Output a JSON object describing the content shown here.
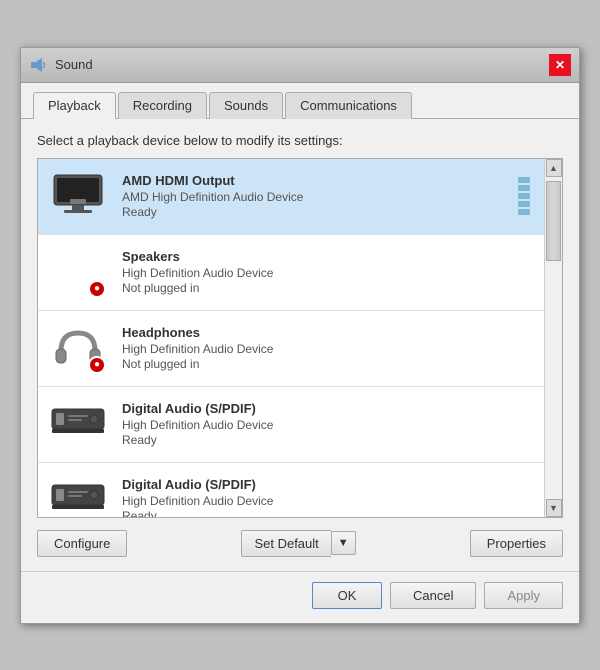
{
  "window": {
    "title": "Sound",
    "icon": "🔊"
  },
  "tabs": [
    {
      "label": "Playback",
      "active": true
    },
    {
      "label": "Recording",
      "active": false
    },
    {
      "label": "Sounds",
      "active": false
    },
    {
      "label": "Communications",
      "active": false
    }
  ],
  "description": "Select a playback device below to modify its settings:",
  "devices": [
    {
      "name": "AMD HDMI Output",
      "driver": "AMD High Definition Audio Device",
      "status": "Ready",
      "selected": true,
      "icon_type": "hdmi",
      "not_plugged": false
    },
    {
      "name": "Speakers",
      "driver": "High Definition Audio Device",
      "status": "Not plugged in",
      "selected": false,
      "icon_type": "speaker",
      "not_plugged": true
    },
    {
      "name": "Headphones",
      "driver": "High Definition Audio Device",
      "status": "Not plugged in",
      "selected": false,
      "icon_type": "headphones",
      "not_plugged": true
    },
    {
      "name": "Digital Audio (S/PDIF)",
      "driver": "High Definition Audio Device",
      "status": "Ready",
      "selected": false,
      "icon_type": "digital",
      "not_plugged": false
    },
    {
      "name": "Digital Audio (S/PDIF)",
      "driver": "High Definition Audio Device",
      "status": "Ready",
      "selected": false,
      "icon_type": "digital",
      "not_plugged": false
    }
  ],
  "buttons": {
    "configure": "Configure",
    "set_default": "Set Default",
    "properties": "Properties",
    "ok": "OK",
    "cancel": "Cancel",
    "apply": "Apply"
  }
}
